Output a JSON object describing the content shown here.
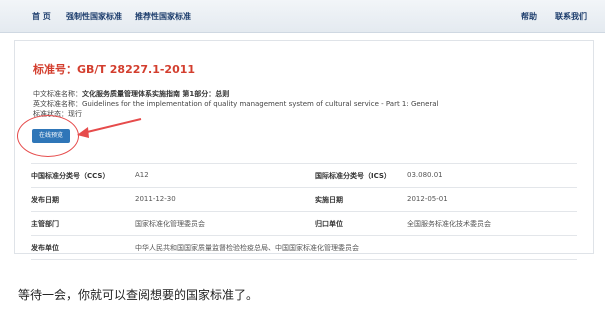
{
  "nav": {
    "items": [
      "首 页",
      "强制性国家标准",
      "推荐性国家标准"
    ],
    "right": [
      "帮助",
      "联系我们"
    ]
  },
  "standard": {
    "title": "标准号：GB/T 28227.1-2011",
    "cn_label": "中文标准名称：",
    "cn_value": "文化服务质量管理体系实施指南 第1部分：总则",
    "en_label": "英文标准名称：",
    "en_value": "Guidelines for the implementation of quality management system of cultural service - Part 1: General",
    "status_label": "标准状态：",
    "status_value": "现行",
    "preview_button": "在线预览"
  },
  "details": [
    {
      "l1": "中国标准分类号（CCS）",
      "v1": "A12",
      "l2": "国际标准分类号（ICS）",
      "v2": "03.080.01"
    },
    {
      "l1": "发布日期",
      "v1": "2011-12-30",
      "l2": "实施日期",
      "v2": "2012-05-01"
    },
    {
      "l1": "主管部门",
      "v1": "国家标准化管理委员会",
      "l2": "归口单位",
      "v2": "全国服务标准化技术委员会"
    },
    {
      "l1": "发布单位",
      "v1": "中华人民共和国国家质量监督检验检疫总局、中国国家标准化管理委员会",
      "l2": "",
      "v2": ""
    }
  ],
  "note": "等待一会，你就可以查阅想要的国家标准了。",
  "colors": {
    "accent": "#2f76b8",
    "highlight": "#e64b4b",
    "title": "#d33e2e"
  }
}
